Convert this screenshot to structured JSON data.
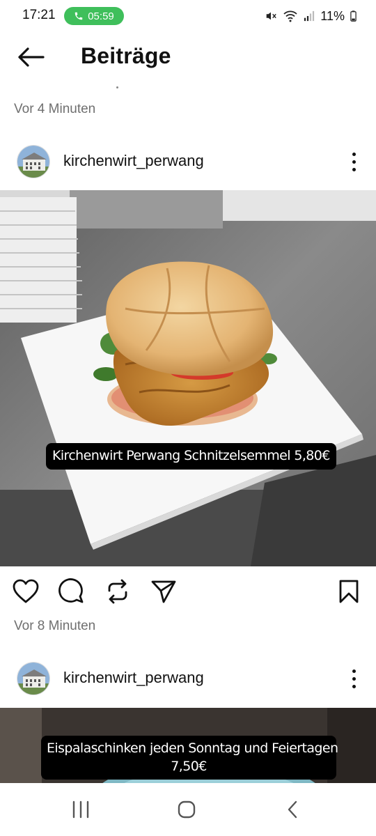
{
  "status_bar": {
    "time": "17:21",
    "call_timer": "05:59",
    "battery": "11%",
    "icons": [
      "mute-icon",
      "wifi-icon",
      "signal-icon",
      "battery-icon"
    ],
    "call_color": "#3fbf5b"
  },
  "header": {
    "title": "Beiträge",
    "back_icon": "arrow-left-icon"
  },
  "posts": [
    {
      "timestamp_above": "Vor 4 Minuten",
      "username": "kirchenwirt_perwang",
      "caption": "Kirchenwirt Perwang Schnitzelsemmel 5,80€",
      "image_subject": "schnitzel-sandwich-photo"
    },
    {
      "timestamp_above": "Vor 8 Minuten",
      "username": "kirchenwirt_perwang",
      "caption_line1": "Eispalaschinken jeden Sonntag und Feiertagen",
      "caption_line2": "7,50€",
      "image_subject": "dessert-photo"
    }
  ],
  "actions": {
    "icons": [
      "heart-icon",
      "comment-icon",
      "repost-icon",
      "share-icon",
      "bookmark-icon"
    ]
  },
  "nav_bar": {
    "icons": [
      "recent-apps-icon",
      "home-icon",
      "back-icon"
    ]
  }
}
